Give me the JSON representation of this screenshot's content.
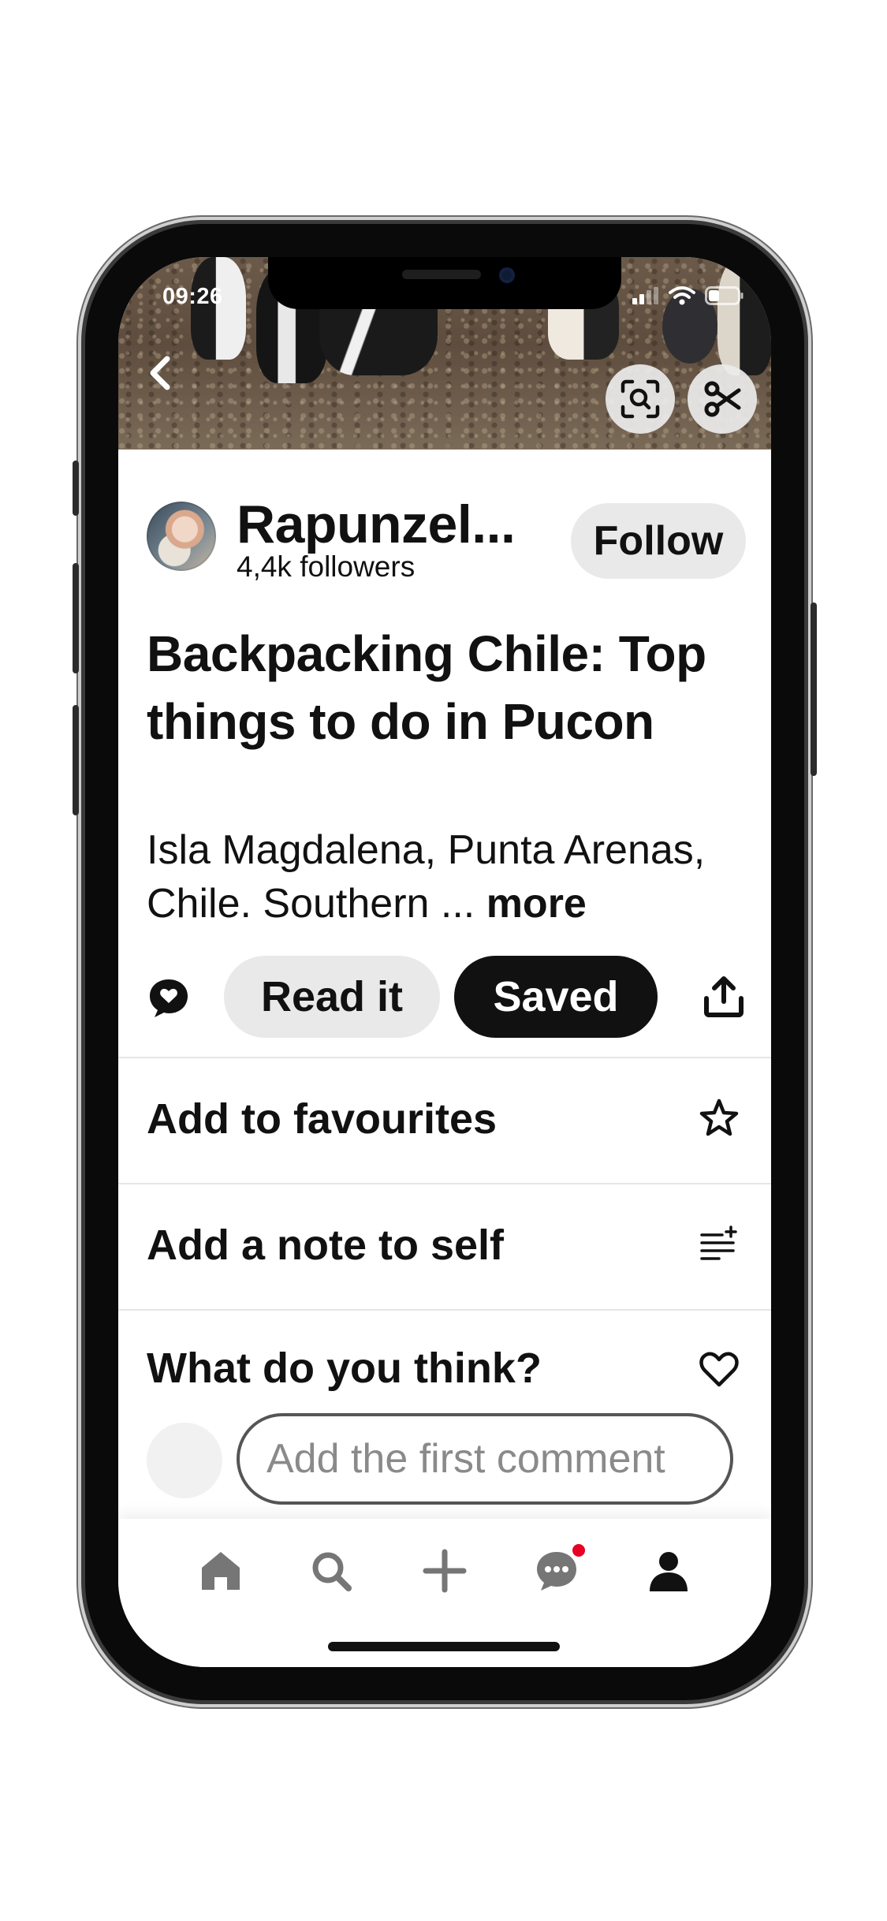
{
  "status_bar": {
    "time": "09:26"
  },
  "header": {
    "back_icon": "chevron-left-icon",
    "lens_icon": "visual-search-icon",
    "cut_icon": "scissors-icon"
  },
  "creator": {
    "name": "Rapunzel...",
    "followers": "4,4k followers",
    "follow_label": "Follow"
  },
  "pin": {
    "title": "Backpacking Chile: Top things to do in Pucon",
    "description": "Isla Magdalena, Punta Arenas, Chile. Southern ...",
    "more_label": "more"
  },
  "actions": {
    "read_label": "Read it",
    "saved_label": "Saved"
  },
  "list": {
    "favourites": "Add to favourites",
    "note": "Add a note to self",
    "think": "What do you think?"
  },
  "comment": {
    "placeholder": "Add the first comment"
  },
  "tabbar": {
    "items": [
      "home-icon",
      "search-icon",
      "plus-icon",
      "messages-icon",
      "profile-icon"
    ],
    "badge_color": "#e60023"
  },
  "colors": {
    "primary_dark": "#111111",
    "button_gray": "#e9e9e9"
  }
}
